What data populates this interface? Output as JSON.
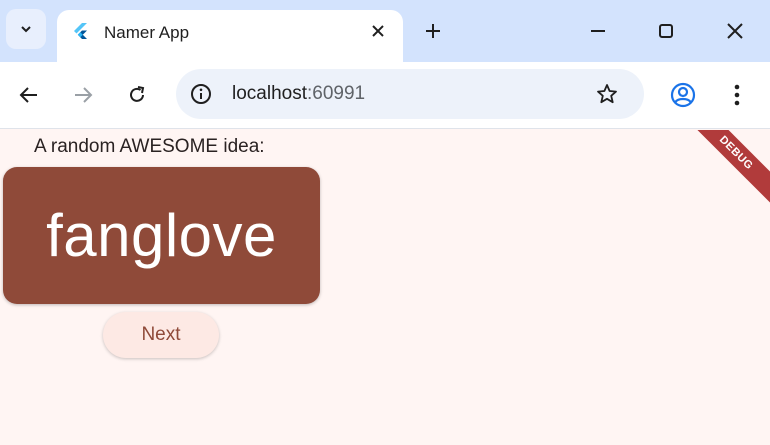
{
  "browser": {
    "tab": {
      "title": "Namer App"
    },
    "address_bar": {
      "host": "localhost",
      "port": ":60991"
    },
    "colors": {
      "tabstrip": "#d3e3fd",
      "omnibox": "#edf2fa",
      "profile_icon": "#1a73e8"
    }
  },
  "app": {
    "label": "A random AWESOME idea:",
    "word": "fanglove",
    "next_label": "Next",
    "debug_banner": "DEBUG",
    "colors": {
      "background": "#fff5f3",
      "card": "#8f4a39",
      "button": "#fde9e4",
      "banner": "#b13b3b"
    }
  },
  "icons": [
    "tab-search-icon",
    "flutter-favicon-icon",
    "tab-close-icon",
    "new-tab-icon",
    "minimize-icon",
    "maximize-icon",
    "close-window-icon",
    "back-arrow-icon",
    "forward-arrow-icon",
    "reload-icon",
    "site-info-icon",
    "bookmark-star-icon",
    "profile-icon",
    "menu-kebab-icon"
  ]
}
